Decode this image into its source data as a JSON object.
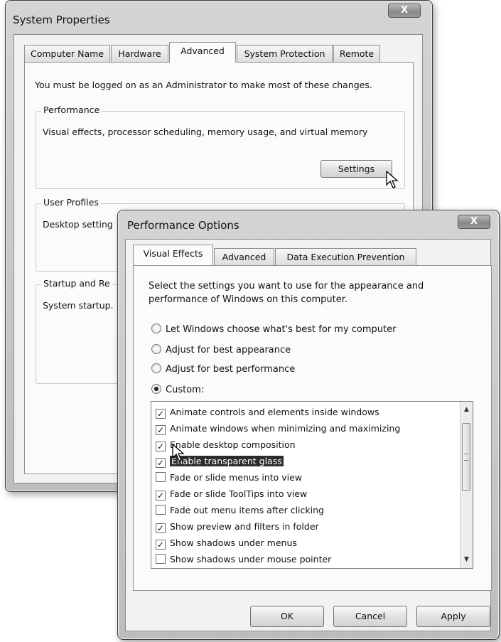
{
  "system_properties": {
    "title": "System Properties",
    "close_label": "X",
    "tabs": [
      "Computer Name",
      "Hardware",
      "Advanced",
      "System Protection",
      "Remote"
    ],
    "active_tab": "Advanced",
    "admin_notice": "You must be logged on as an Administrator to make most of these changes.",
    "performance": {
      "label": "Performance",
      "description": "Visual effects, processor scheduling, memory usage, and virtual memory",
      "settings_button": "Settings"
    },
    "user_profiles": {
      "label": "User Profiles",
      "description": "Desktop setting"
    },
    "startup": {
      "label": "Startup and Re",
      "description": "System startup."
    }
  },
  "performance_options": {
    "title": "Performance Options",
    "close_label": "X",
    "tabs": [
      "Visual Effects",
      "Advanced",
      "Data Execution Prevention"
    ],
    "active_tab": "Visual Effects",
    "intro_line1": "Select the settings you want to use for the appearance and",
    "intro_line2": "performance of Windows on this computer.",
    "radios": [
      {
        "label": "Let Windows choose what's best for my computer",
        "selected": false
      },
      {
        "label": "Adjust for best appearance",
        "selected": false
      },
      {
        "label": "Adjust for best performance",
        "selected": false
      },
      {
        "label": "Custom:",
        "selected": true
      }
    ],
    "effects": [
      {
        "label": "Animate controls and elements inside windows",
        "checked": true
      },
      {
        "label": "Animate windows when minimizing and maximizing",
        "checked": true
      },
      {
        "label": "Enable desktop composition",
        "checked": true
      },
      {
        "label": "Enable transparent glass",
        "checked": true,
        "highlighted": true
      },
      {
        "label": "Fade or slide menus into view",
        "checked": false
      },
      {
        "label": "Fade or slide ToolTips into view",
        "checked": true
      },
      {
        "label": "Fade out menu items after clicking",
        "checked": false
      },
      {
        "label": "Show preview and filters in folder",
        "checked": true
      },
      {
        "label": "Show shadows under menus",
        "checked": true
      },
      {
        "label": "Show shadows under mouse pointer",
        "checked": false
      }
    ],
    "buttons": {
      "ok": "OK",
      "cancel": "Cancel",
      "apply": "Apply"
    }
  }
}
